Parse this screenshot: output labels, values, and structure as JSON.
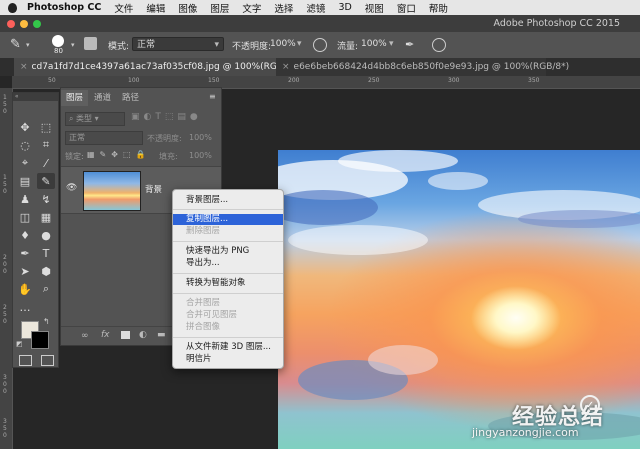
{
  "menubar": {
    "app_name": "Photoshop CC",
    "items": [
      "文件",
      "编辑",
      "图像",
      "图层",
      "文字",
      "选择",
      "滤镜",
      "3D",
      "视图",
      "窗口",
      "帮助"
    ]
  },
  "titlebar": {
    "title": "Adobe Photoshop CC 2015"
  },
  "options_bar": {
    "brush_size": "80",
    "mode_label": "模式:",
    "mode_value": "正常",
    "opacity_label": "不透明度:",
    "opacity_value": "100%",
    "flow_label": "流量:",
    "flow_value": "100%"
  },
  "tabs": [
    {
      "label": "cd7a1fd7d1ce4397a61ac73af035cf08.jpg @ 100%(RGB/8*) *"
    },
    {
      "label": "e6e6beb668424d4bb8c6eb850f0e9e93.jpg @ 100%(RGB/8*)"
    }
  ],
  "ruler_top": [
    "50",
    "100",
    "150",
    "200",
    "250",
    "300",
    "350"
  ],
  "ruler_left": [
    "1",
    "5",
    "0",
    "1",
    "5",
    "0",
    "2",
    "0",
    "0",
    "2",
    "5",
    "0",
    "3",
    "0",
    "0",
    "3",
    "5",
    "0"
  ],
  "layers_panel": {
    "tabs": [
      "图层",
      "通道",
      "路径"
    ],
    "filter_placeholder": "类型",
    "blend_mode": "正常",
    "opacity_label": "不透明度:",
    "opacity_value": "100%",
    "lock_label": "锁定:",
    "fill_label": "填充:",
    "fill_value": "100%",
    "layer_name": "背景"
  },
  "context_menu": {
    "groups": [
      [
        {
          "label": "背景图层...",
          "enabled": true
        }
      ],
      [
        {
          "label": "复制图层...",
          "enabled": true,
          "highlighted": true
        },
        {
          "label": "删除图层",
          "enabled": false
        }
      ],
      [
        {
          "label": "快速导出为 PNG",
          "enabled": true
        },
        {
          "label": "导出为...",
          "enabled": true
        }
      ],
      [
        {
          "label": "转换为智能对象",
          "enabled": true
        }
      ],
      [
        {
          "label": "合并图层",
          "enabled": false
        },
        {
          "label": "合并可见图层",
          "enabled": false
        },
        {
          "label": "拼合图像",
          "enabled": false
        }
      ],
      [
        {
          "label": "从文件新建 3D 图层...",
          "enabled": true
        },
        {
          "label": "明信片",
          "enabled": true
        }
      ]
    ]
  },
  "watermark": {
    "text": "经验总结",
    "url": "jingyanzongjie.com"
  },
  "colors": {
    "highlight": "#2d63d8",
    "panel": "#535353",
    "menu_bg": "#ececec"
  }
}
